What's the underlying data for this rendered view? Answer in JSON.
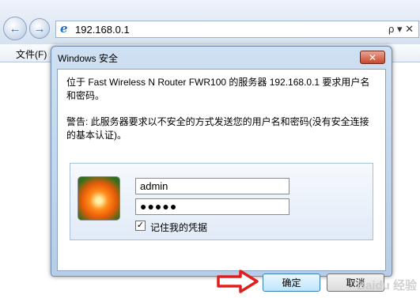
{
  "browser": {
    "address": "192.168.0.1",
    "address_tools": "ρ ▾ ✕",
    "menu_file": "文件(F)"
  },
  "dialog": {
    "title": "Windows 安全",
    "close_label": "✕",
    "message_line1": "位于 Fast Wireless N Router FWR100 的服务器 192.168.0.1 要求用户名和密码。",
    "message_line2": "警告: 此服务器要求以不安全的方式发送您的用户名和密码(没有安全连接的基本认证)。",
    "username_value": "admin",
    "password_value": "●●●●●",
    "remember_checked": true,
    "remember_label": "记住我的凭据",
    "ok_label": "确定",
    "cancel_label": "取消"
  },
  "watermark": "Baidu 经验",
  "colors": {
    "arrow": "#e01e1e"
  }
}
